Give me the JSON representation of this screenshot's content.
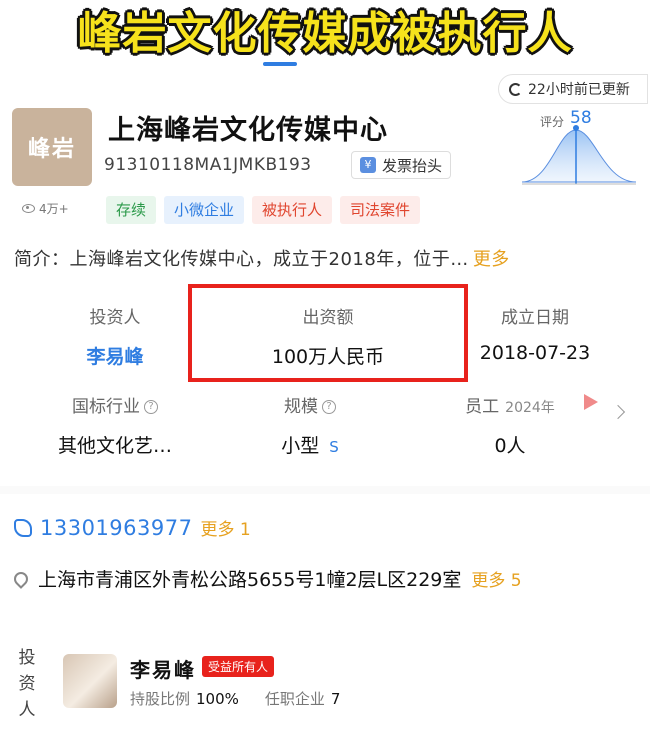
{
  "headline": "峰岩文化传媒成被执行人",
  "update_status": "22小时前已更新",
  "company": {
    "logo_text": "峰岩",
    "name": "上海峰岩文化传媒中心",
    "credit_code": "91310118MA1JMKB193",
    "invoice_button": "发票抬头",
    "score_label": "评分",
    "score_value": "58",
    "views": "4万+",
    "tags": [
      {
        "label": "存续",
        "color": "#2c9a4a"
      },
      {
        "label": "小微企业",
        "color": "#2f7de1"
      },
      {
        "label": "被执行人",
        "color": "#e0452e"
      },
      {
        "label": "司法案件",
        "color": "#e0452e"
      }
    ],
    "intro_label": "简介：",
    "intro_text": "上海峰岩文化传媒中心，成立于2018年，位于…",
    "intro_more": "更多"
  },
  "info": {
    "investor_label": "投资人",
    "investor_value": "李易峰",
    "capital_label": "出资额",
    "capital_value": "100万人民币",
    "founded_label": "成立日期",
    "founded_value": "2018-07-23",
    "industry_label": "国标行业",
    "industry_value": "其他文化艺…",
    "scale_label": "规模",
    "scale_value": "小型",
    "scale_badge": "S",
    "employees_label": "员工",
    "employees_year": "2024年",
    "employees_value": "0人"
  },
  "contact": {
    "phone": "13301963977",
    "phone_more": "更多 1",
    "address": "上海市青浦区外青松公路5655号1幢2层L区229室",
    "address_more": "更多 5"
  },
  "investor_section": {
    "label": "投资人",
    "name": "李易峰",
    "badge": "受益所有人",
    "holding_label": "持股比例",
    "holding_value": "100%",
    "positions_label": "任职企业",
    "positions_value": "7"
  }
}
